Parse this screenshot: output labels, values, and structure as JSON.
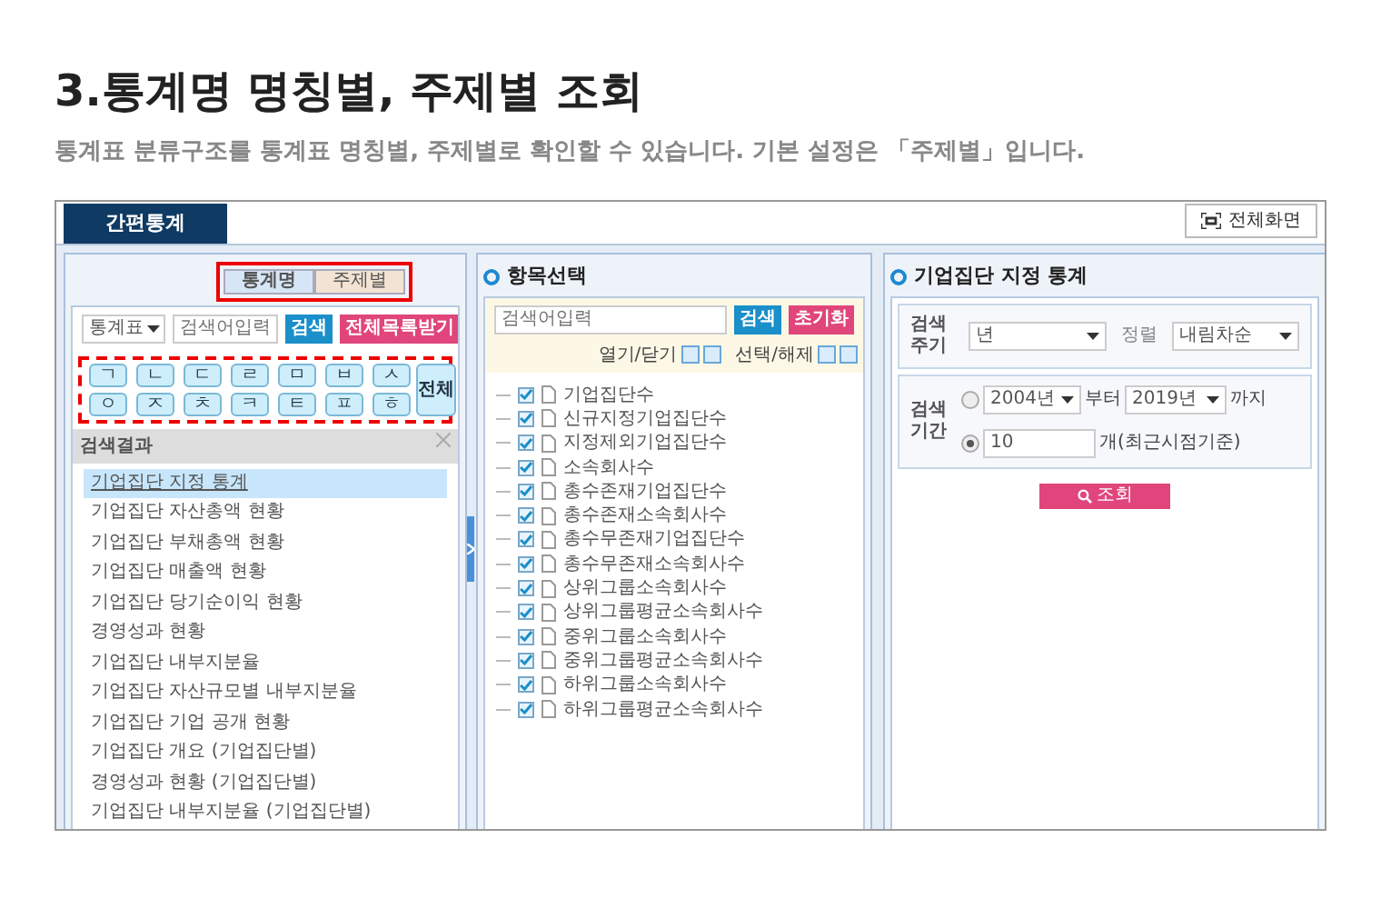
{
  "heading": "3.통계명 명칭별, 주제별 조회",
  "subtitle": "통계표 분류구조를 통계표 명칭별, 주제별로 확인할 수 있습니다. 기본 설정은 「주제별」입니다.",
  "app": {
    "tab": "간편통계",
    "fullscreen_button": "전체화면",
    "left": {
      "toggle": [
        {
          "label": "통계명",
          "selected": true
        },
        {
          "label": "주제별",
          "selected": false
        }
      ],
      "select": "통계표",
      "placeholder": "검색어입력",
      "search_button": "검색",
      "all_list_button": "전체목록받기",
      "consonants": [
        "ㄱ",
        "ㄴ",
        "ㄷ",
        "ㄹ",
        "ㅁ",
        "ㅂ",
        "ㅅ",
        "ㅇ",
        "ㅈ",
        "ㅊ",
        "ㅋ",
        "ㅌ",
        "ㅍ",
        "ㅎ"
      ],
      "all_consonant": "전체",
      "results_title": "검색결과",
      "results": [
        {
          "label": "기업집단 지정 통계",
          "selected": true
        },
        {
          "label": "기업집단 자산총액 현황",
          "selected": false
        },
        {
          "label": "기업집단 부채총액 현황",
          "selected": false
        },
        {
          "label": "기업집단 매출액 현황",
          "selected": false
        },
        {
          "label": "기업집단 당기순이익 현황",
          "selected": false
        },
        {
          "label": "경영성과 현황",
          "selected": false
        },
        {
          "label": "기업집단 내부지분율",
          "selected": false
        },
        {
          "label": "기업집단 자산규모별 내부지분율",
          "selected": false
        },
        {
          "label": "기업집단 기업 공개 현황",
          "selected": false
        },
        {
          "label": "기업집단 개요 (기업집단별)",
          "selected": false
        },
        {
          "label": "경영성과 현황 (기업집단별)",
          "selected": false
        },
        {
          "label": "기업집단 내부지분율 (기업집단별)",
          "selected": false
        }
      ]
    },
    "middle": {
      "title": "항목선택",
      "placeholder": "검색어입력",
      "search_button": "검색",
      "reset_button": "초기화",
      "expand_label": "열기/닫기",
      "select_label": "선택/해제",
      "items": [
        {
          "label": "기업집단수",
          "checked": true
        },
        {
          "label": "신규지정기업집단수",
          "checked": true
        },
        {
          "label": "지정제외기업집단수",
          "checked": true
        },
        {
          "label": "소속회사수",
          "checked": true
        },
        {
          "label": "총수존재기업집단수",
          "checked": true
        },
        {
          "label": "총수존재소속회사수",
          "checked": true
        },
        {
          "label": "총수무존재기업집단수",
          "checked": true
        },
        {
          "label": "총수무존재소속회사수",
          "checked": true
        },
        {
          "label": "상위그룹소속회사수",
          "checked": true
        },
        {
          "label": "상위그룹평균소속회사수",
          "checked": true
        },
        {
          "label": "중위그룹소속회사수",
          "checked": true
        },
        {
          "label": "중위그룹평균소속회사수",
          "checked": true
        },
        {
          "label": "하위그룹소속회사수",
          "checked": true
        },
        {
          "label": "하위그룹평균소속회사수",
          "checked": true
        }
      ]
    },
    "right": {
      "title": "기업집단 지정 통계",
      "cycle_label": "검색 주기",
      "cycle": "년",
      "sort_label": "정렬",
      "sort": "내림차순",
      "period_label": "검색 기간",
      "period_options": [
        {
          "kind": "range",
          "selected": false,
          "from": "2004년",
          "from_suffix": "부터",
          "to": "2019년",
          "to_suffix": "까지"
        },
        {
          "kind": "count",
          "selected": true,
          "value": "10",
          "suffix": "개(최근시점기준)"
        }
      ],
      "query_button": "조회"
    }
  }
}
